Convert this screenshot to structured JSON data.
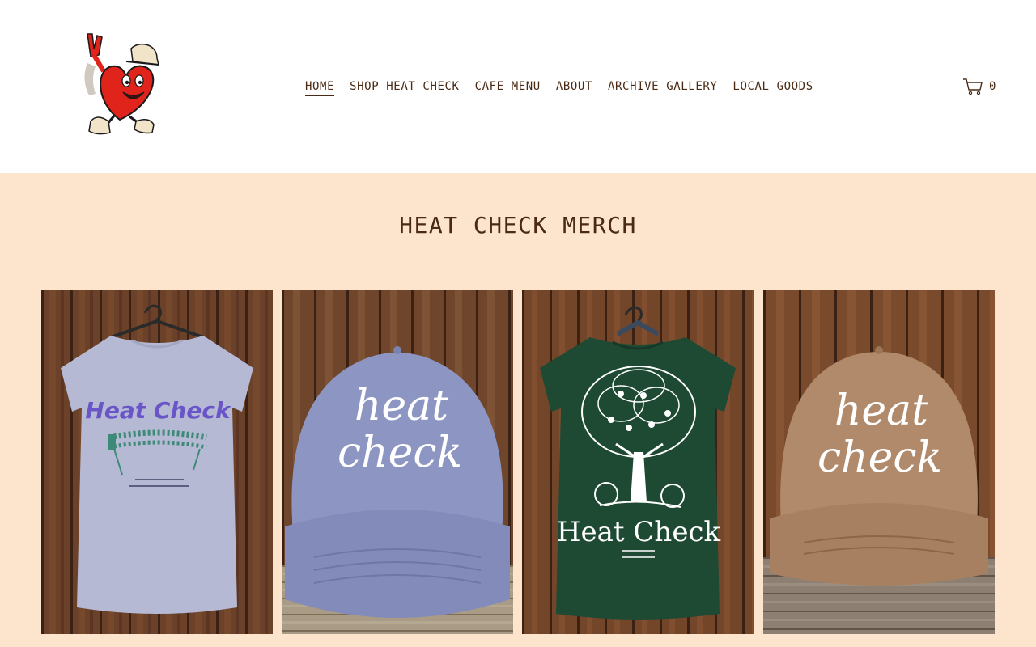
{
  "header": {
    "logo": {
      "icon": "heart-mascot-logo"
    },
    "nav": [
      {
        "label": "HOME",
        "active": true
      },
      {
        "label": "SHOP HEAT CHECK",
        "active": false
      },
      {
        "label": "CAFE MENU",
        "active": false
      },
      {
        "label": "ABOUT",
        "active": false
      },
      {
        "label": "ARCHIVE GALLERY",
        "active": false
      },
      {
        "label": "LOCAL GOODS",
        "active": false
      }
    ],
    "cart": {
      "icon": "cart-icon",
      "count": "0"
    }
  },
  "main": {
    "title": "HEAT CHECK MERCH",
    "products": [
      {
        "image": "grey-tshirt-heat-check-print",
        "print_text": "Heat Check"
      },
      {
        "image": "blue-cap-heat-check",
        "print_text": [
          "heat",
          "check"
        ]
      },
      {
        "image": "green-tshirt-tree-print",
        "print_text": "Heat Check"
      },
      {
        "image": "tan-cap-heat-check",
        "print_text": [
          "heat",
          "check"
        ]
      }
    ]
  },
  "colors": {
    "text": "#4a2a14",
    "main_background": "#fde5cd",
    "header_background": "#ffffff"
  }
}
